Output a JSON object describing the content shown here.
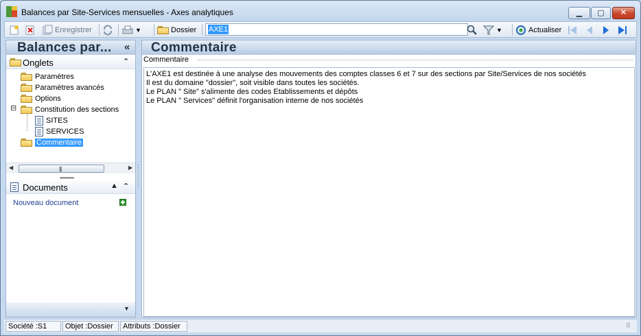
{
  "window": {
    "title": "Balances par Site-Services mensuelles -  Axes analytiques",
    "controls": {
      "minimize": "▁",
      "maximize": "▢",
      "close": "✕"
    }
  },
  "toolbar": {
    "save_label": "Enregistrer",
    "folder_label": "Dossier",
    "search_value": "AXE1",
    "refresh_label": "Actualiser",
    "icons": [
      "new-record-icon",
      "delete-icon",
      "save-icon",
      "sync-icon",
      "print-icon",
      "folder-icon",
      "search-icon",
      "filter-icon",
      "refresh-icon",
      "first-icon",
      "previous-icon",
      "next-icon",
      "last-icon"
    ]
  },
  "left_panel": {
    "title": "Balances par...",
    "collapse_glyph": "«",
    "tabs_section": {
      "label": "Onglets",
      "collapse_glyph": "⌃"
    },
    "tree": [
      {
        "label": "Paramètres",
        "type": "folder"
      },
      {
        "label": "Paramètres avancés",
        "type": "folder"
      },
      {
        "label": "Options",
        "type": "folder"
      },
      {
        "label": "Constitution des sections",
        "type": "folder-open",
        "expander": "⊟"
      },
      {
        "label": "SITES",
        "type": "document"
      },
      {
        "label": "SERVICES",
        "type": "document"
      },
      {
        "label": "Commentaire",
        "type": "folder-open",
        "selected": true
      }
    ],
    "scroll_grip": "|||",
    "documents_section": {
      "label": "Documents",
      "collapse_glyph": "⌃"
    },
    "new_document": "Nouveau document"
  },
  "right_panel": {
    "title": "Commentaire",
    "group_label": "Commentaire",
    "comment_lines": [
      "L'AXE1  est  destinée  à  une  analyse  des  mouvements  des  comptes  classes  6 et 7  sur  des  sections  par  Site/Services  de  nos  sociétés",
      "Il est  du  domaine  \"dossier\",  soit  visible  dans  toutes  les  sociétés.",
      "Le  PLAN  \"  Site\"  s'alimente  des  codes  Etablissements  et  dépôts",
      "Le  PLAN  \" Services\"  définit  l'organisation  interne  de  nos  sociétés"
    ]
  },
  "status_bar": {
    "societe": "Société :S1",
    "objet": "Objet :Dossier",
    "attributs": "Attributs :Dossier"
  },
  "colors": {
    "selection": "#3399ff",
    "header_text": "#243447",
    "window_bg": "#c6d9ee",
    "link": "#1f3f8f"
  }
}
